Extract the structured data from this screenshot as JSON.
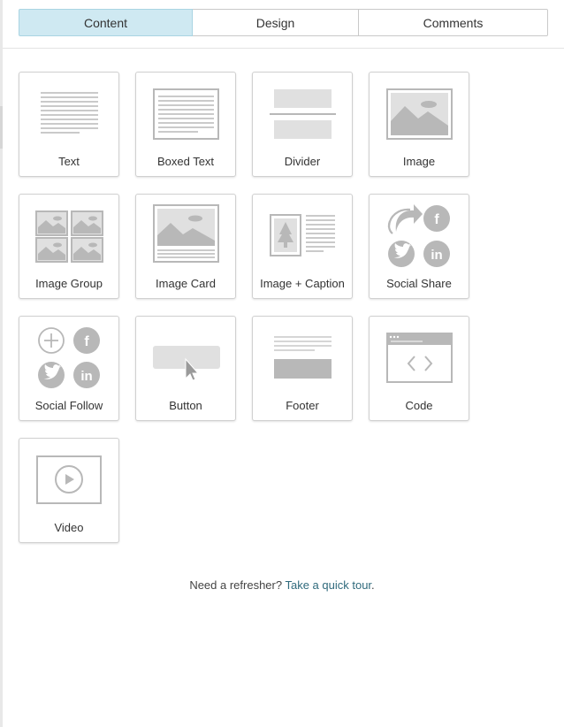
{
  "tabs": [
    {
      "label": "Content",
      "active": true
    },
    {
      "label": "Design",
      "active": false
    },
    {
      "label": "Comments",
      "active": false
    }
  ],
  "blocks": [
    {
      "label": "Text",
      "icon": "text-block-icon"
    },
    {
      "label": "Boxed Text",
      "icon": "boxed-text-block-icon"
    },
    {
      "label": "Divider",
      "icon": "divider-block-icon"
    },
    {
      "label": "Image",
      "icon": "image-block-icon"
    },
    {
      "label": "Image Group",
      "icon": "image-group-block-icon"
    },
    {
      "label": "Image Card",
      "icon": "image-card-block-icon"
    },
    {
      "label": "Image + Caption",
      "icon": "image-caption-block-icon"
    },
    {
      "label": "Social Share",
      "icon": "social-share-block-icon"
    },
    {
      "label": "Social Follow",
      "icon": "social-follow-block-icon"
    },
    {
      "label": "Button",
      "icon": "button-block-icon"
    },
    {
      "label": "Footer",
      "icon": "footer-block-icon"
    },
    {
      "label": "Code",
      "icon": "code-block-icon"
    },
    {
      "label": "Video",
      "icon": "video-block-icon"
    }
  ],
  "refresher": {
    "prefix": "Need a refresher?",
    "link": "Take a quick tour",
    "suffix": "."
  },
  "colors": {
    "active_tab": "#cfe9f2",
    "icon_gray": "#b8b8b8",
    "link": "#2f6a7c"
  }
}
